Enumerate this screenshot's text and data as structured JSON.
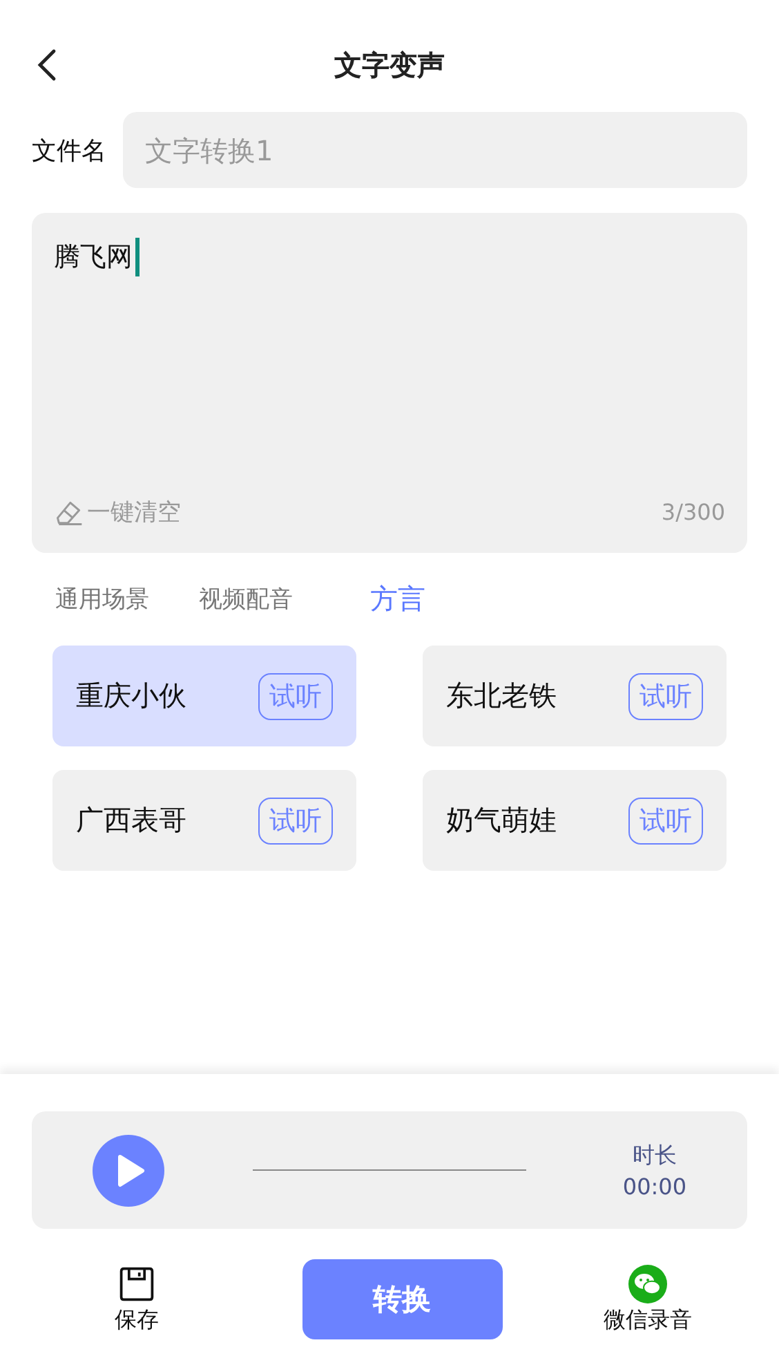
{
  "header": {
    "title": "文字变声"
  },
  "file_name": {
    "label": "文件名",
    "placeholder": "文字转换1"
  },
  "text_input": {
    "value": "腾飞网",
    "clear_label": "一键清空",
    "counter": "3/300"
  },
  "tabs": [
    {
      "label": "通用场景",
      "selected": false
    },
    {
      "label": "视频配音",
      "selected": false
    },
    {
      "label": "方言",
      "selected": true
    }
  ],
  "voices": [
    {
      "name": "重庆小伙",
      "preview": "试听",
      "selected": true
    },
    {
      "name": "东北老铁",
      "preview": "试听",
      "selected": false
    },
    {
      "name": "广西表哥",
      "preview": "试听",
      "selected": false
    },
    {
      "name": "奶气萌娃",
      "preview": "试听",
      "selected": false
    }
  ],
  "player": {
    "duration_label": "时长",
    "duration": "00:00"
  },
  "bottom_bar": {
    "save": "保存",
    "convert": "转换",
    "wechat": "微信录音"
  }
}
